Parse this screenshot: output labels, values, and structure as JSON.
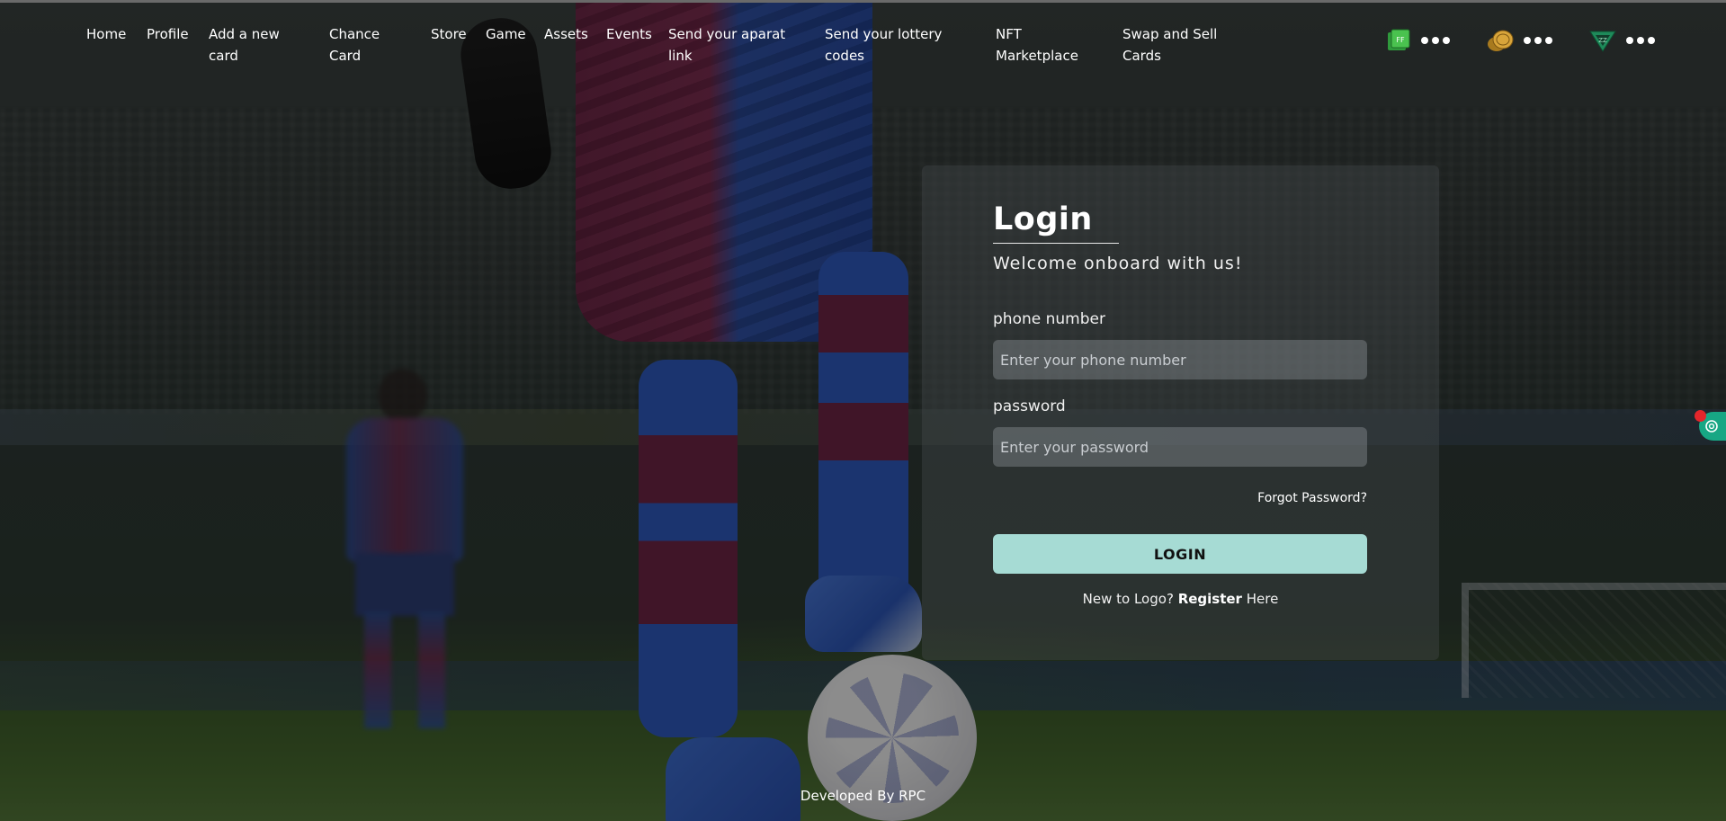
{
  "nav": {
    "items": [
      {
        "label": "Home"
      },
      {
        "label": "Profile"
      },
      {
        "label": "Add a new card"
      },
      {
        "label": "Chance Card"
      },
      {
        "label": "Store"
      },
      {
        "label": "Game"
      },
      {
        "label": "Assets"
      },
      {
        "label": "Events"
      },
      {
        "label": "Send your aparat link"
      },
      {
        "label": "Send your lottery codes"
      },
      {
        "label": "NFT Marketplace"
      },
      {
        "label": "Swap and Sell Cards"
      }
    ]
  },
  "coins": [
    {
      "icon": "cash-coin-icon",
      "value": "•••"
    },
    {
      "icon": "gold-coin-icon",
      "value": "•••"
    },
    {
      "icon": "token-coin-icon",
      "value": "•••"
    }
  ],
  "login": {
    "title": "Login",
    "subtitle": "Welcome onboard with us!",
    "phone_label": "phone number",
    "phone_placeholder": "Enter your phone number",
    "password_label": "password",
    "password_placeholder": "Enter your password",
    "forgot": "Forgot Password?",
    "button": "LOGIN",
    "register_prefix": "New to Logo?",
    "register_link": "Register",
    "register_suffix": "Here"
  },
  "footer": {
    "text": "Developed By RPC"
  },
  "colors": {
    "login_button": "#a6dbd4",
    "side_widget": "#17a784",
    "notification_dot": "#e4262b"
  }
}
